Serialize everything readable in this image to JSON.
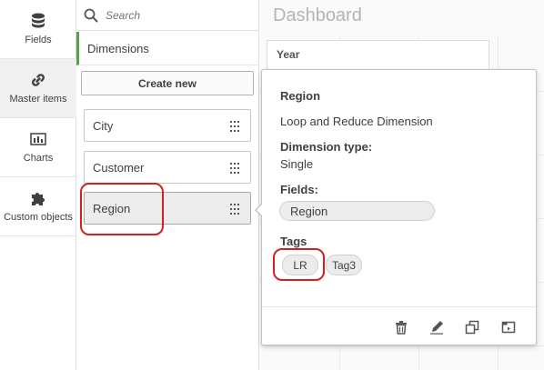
{
  "rail": {
    "items": [
      {
        "label": "Fields",
        "icon": "database-icon"
      },
      {
        "label": "Master items",
        "icon": "link-icon"
      },
      {
        "label": "Charts",
        "icon": "bar-chart-icon"
      },
      {
        "label": "Custom objects",
        "icon": "puzzle-icon"
      }
    ]
  },
  "panel": {
    "search_placeholder": "Search",
    "section_header": "Dimensions",
    "create_new_label": "Create new",
    "dimensions": [
      {
        "label": "City"
      },
      {
        "label": "Customer"
      },
      {
        "label": "Region"
      }
    ]
  },
  "dashboard": {
    "title": "Dashboard",
    "table_header": "Year"
  },
  "popover": {
    "title": "Region",
    "description": "Loop and Reduce Dimension",
    "dimension_type_label": "Dimension type:",
    "dimension_type_value": "Single",
    "fields_label": "Fields:",
    "fields": [
      "Region"
    ],
    "tags_label": "Tags",
    "tags": [
      "LR",
      "Tag3"
    ],
    "footer_icons": [
      "trash-icon",
      "edit-icon",
      "duplicate-icon",
      "export-icon"
    ]
  },
  "colors": {
    "accent_green": "#52a34b",
    "highlight_red": "#d62020"
  }
}
